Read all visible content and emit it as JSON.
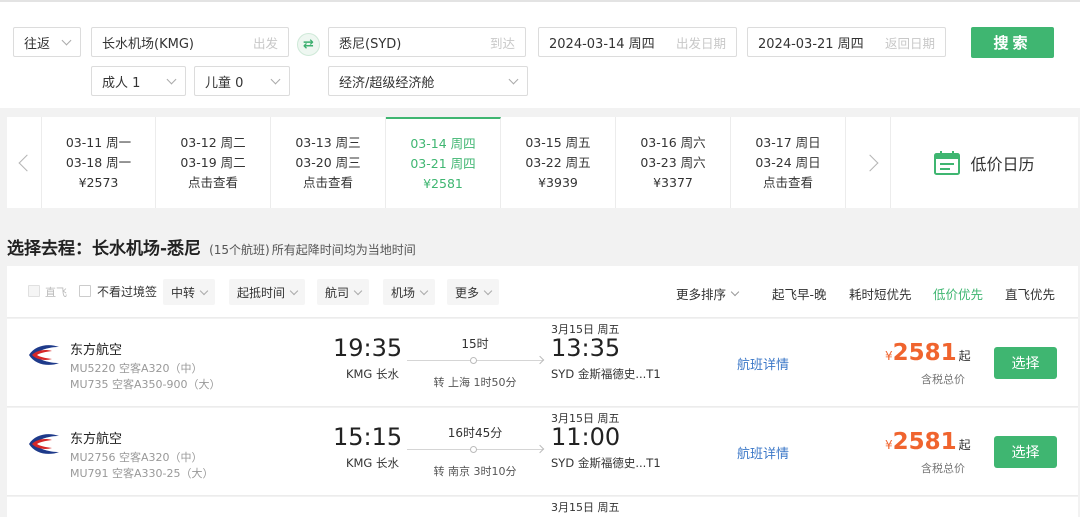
{
  "search": {
    "trip_type": "往返",
    "from_city": "长水机场(KMG)",
    "from_hint": "出发",
    "to_city": "悉尼(SYD)",
    "to_hint": "到达",
    "depart_date": "2024-03-14 周四",
    "depart_hint": "出发日期",
    "return_date": "2024-03-21 周四",
    "return_hint": "返回日期",
    "search_label": "搜索",
    "adults": "成人 1",
    "children": "儿童 0",
    "cabin": "经济/超级经济舱",
    "swap_icon": "⇄"
  },
  "date_strip": {
    "cells": [
      {
        "out": "03-11 周一",
        "ret": "03-18 周一",
        "price": "¥2573"
      },
      {
        "out": "03-12 周二",
        "ret": "03-19 周二",
        "price": "点击查看"
      },
      {
        "out": "03-13 周三",
        "ret": "03-20 周三",
        "price": "点击查看"
      },
      {
        "out": "03-14 周四",
        "ret": "03-21 周四",
        "price": "¥2581"
      },
      {
        "out": "03-15 周五",
        "ret": "03-22 周五",
        "price": "¥3939"
      },
      {
        "out": "03-16 周六",
        "ret": "03-23 周六",
        "price": "¥3377"
      },
      {
        "out": "03-17 周日",
        "ret": "03-24 周日",
        "price": "点击查看"
      }
    ],
    "calendar_label": "低价日历"
  },
  "heading": {
    "title": "选择去程：长水机场-悉尼",
    "count": "(15个航班)",
    "note": "所有起降时间均为当地时间"
  },
  "filters": {
    "direct": "直飞",
    "no_transit_visa": "不看过境签",
    "buttons": [
      "中转",
      "起抵时间",
      "航司",
      "机场",
      "更多"
    ],
    "sorts": [
      "更多排序",
      "起飞早-晚",
      "耗时短优先",
      "低价优先",
      "直飞优先"
    ]
  },
  "flights": [
    {
      "airline": "东方航空",
      "flight1": "MU5220 空客A320（中）",
      "flight2": "MU735 空客A350-900（大）",
      "dep_time": "19:35",
      "dep_airport": "KMG 长水",
      "duration": "15时",
      "transfer": "转 上海 1时50分",
      "arr_date": "3月15日 周五",
      "arr_time": "13:35",
      "arr_airport": "SYD 金斯福德史...T1",
      "detail": "航班详情",
      "yen": "¥",
      "price": "2581",
      "qi": "起",
      "tax": "含税总价",
      "select": "选择"
    },
    {
      "airline": "东方航空",
      "flight1": "MU2756 空客A320（中）",
      "flight2": "MU791 空客A330-25（大）",
      "dep_time": "15:15",
      "dep_airport": "KMG 长水",
      "duration": "16时45分",
      "transfer": "转 南京 3时10分",
      "arr_date": "3月15日 周五",
      "arr_time": "11:00",
      "arr_airport": "SYD 金斯福德史...T1",
      "detail": "航班详情",
      "yen": "¥",
      "price": "2581",
      "qi": "起",
      "tax": "含税总价",
      "select": "选择"
    },
    {
      "arr_date": "3月15日 周五"
    }
  ],
  "colors": {
    "accent": "#3fb671",
    "price": "#f0642e",
    "link": "#3c78c8"
  }
}
